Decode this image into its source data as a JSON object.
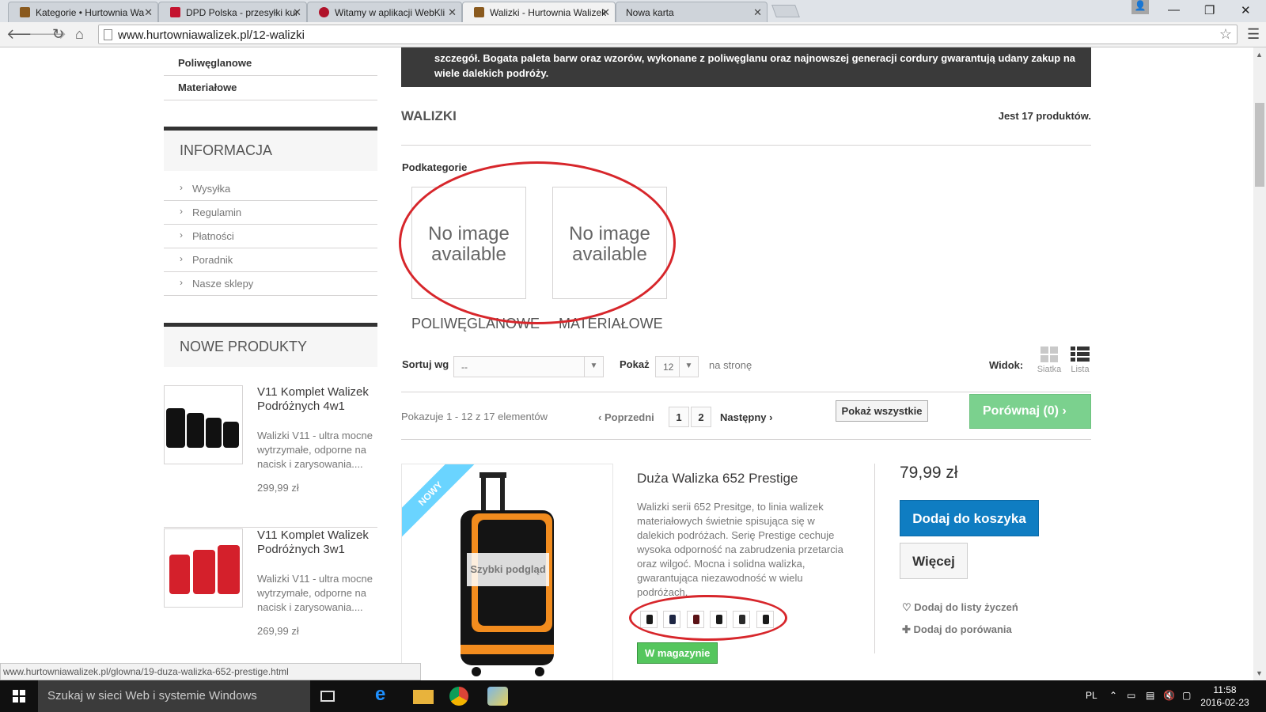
{
  "browser": {
    "tabs": [
      {
        "title": "Kategorie • Hurtownia Wa",
        "active": false
      },
      {
        "title": "DPD Polska - przesyłki kur",
        "active": false
      },
      {
        "title": "Witamy w aplikacji WebKli",
        "active": false
      },
      {
        "title": "Walizki - Hurtownia Walizek",
        "active": true
      },
      {
        "title": "Nowa karta",
        "active": false
      }
    ],
    "url": "www.hurtowniawalizek.pl/12-walizki",
    "status_url": "www.hurtowniawalizek.pl/glowna/19-duza-walizka-652-prestige.html"
  },
  "sidebar": {
    "categories": [
      "Poliwęglanowe",
      "Materiałowe"
    ],
    "info_title": "INFORMACJA",
    "info_items": [
      "Wysyłka",
      "Regulamin",
      "Płatności",
      "Poradnik",
      "Nasze sklepy"
    ],
    "new_title": "NOWE PRODUKTY",
    "new_products": [
      {
        "name": "V11 Komplet Walizek Podróżnych 4w1",
        "desc": "Walizki V11 - ultra mocne wytrzymałe, odporne na nacisk i zarysowania....",
        "price": "299,99 zł"
      },
      {
        "name": "V11 Komplet Walizek Podróżnych 3w1",
        "desc": "Walizki V11 - ultra mocne wytrzymałe, odporne na nacisk i zarysowania....",
        "price": "269,99 zł"
      }
    ]
  },
  "category": {
    "description_line1": "szczegół. Bogata paleta barw oraz wzorów, wykonane z poliwęglanu oraz najnowszej generacji cordury gwarantują udany zakup na",
    "description_line2": "wiele dalekich podróży.",
    "title": "WALIZKI",
    "count": "Jest 17 produktów.",
    "subcategories_label": "Podkategorie",
    "subcategories": [
      {
        "image_text": "No image available",
        "name": "POLIWĘGLANOWE"
      },
      {
        "image_text": "No image available",
        "name": "MATERIAŁOWE"
      }
    ]
  },
  "sorting": {
    "sort_label": "Sortuj wg",
    "sort_value": "--",
    "show_label": "Pokaż",
    "show_value": "12",
    "per_page": "na stronę",
    "view_label": "Widok:",
    "view_grid": "Siatka",
    "view_list": "Lista"
  },
  "pagination": {
    "showing": "Pokazuje 1 - 12 z 17 elementów",
    "prev": "Poprzedni",
    "pages": [
      "1",
      "2"
    ],
    "next": "Następny",
    "show_all": "Pokaż wszystkie",
    "compare": "Porównaj (0)"
  },
  "product": {
    "badge": "NOWY",
    "quick_view": "Szybki podgląd",
    "name": "Duża Walizka 652 Prestige",
    "description": "Walizki serii 652 Presitge, to linia walizek materiałowych świetnie spisująca się w dalekich podróżach. Serię Prestige cechuje wysoka odporność na zabrudzenia przetarcia oraz wilgoć. Mocna i solidna walizka, gwarantująca niezawodność w wielu podróżach.",
    "stock": "W magazynie",
    "price": "79,99 zł",
    "add_to_cart": "Dodaj do koszyka",
    "more": "Więcej",
    "wishlist": "Dodaj do listy życzeń",
    "add_compare": "Dodaj do porówania"
  },
  "taskbar": {
    "search": "Szukaj w sieci Web i systemie Windows",
    "lang": "PL",
    "time": "11:58",
    "date": "2016-02-23"
  },
  "colors": {
    "accent_blue": "#0f7dc2",
    "compare_green": "#7bd18e",
    "stock_green": "#55c65e",
    "ribbon_blue": "#6ad4ff",
    "annotation_red": "#d7262b"
  }
}
